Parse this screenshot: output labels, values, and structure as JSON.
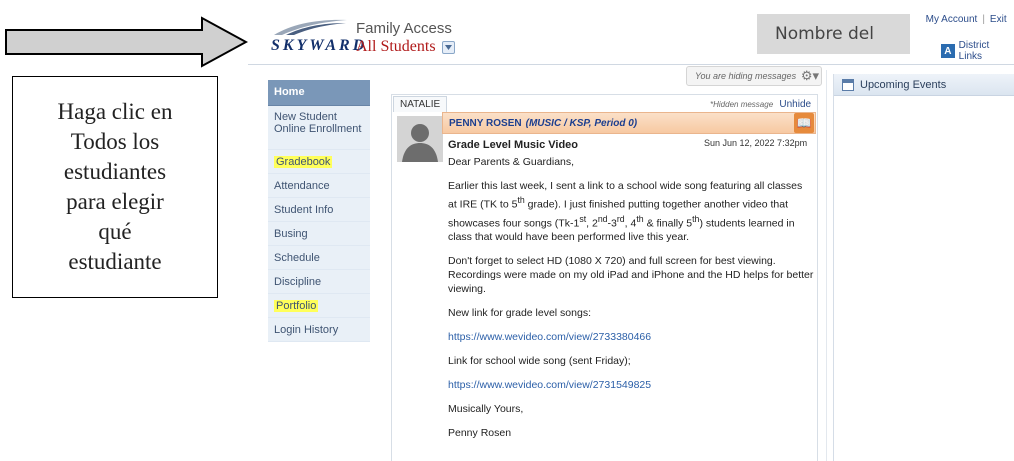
{
  "callout": {
    "lines": [
      "Haga clic en",
      "Todos los",
      "estudiantes",
      "para elegir",
      "qué",
      "estudiante"
    ]
  },
  "name_overlay": "Nombre del",
  "header": {
    "app_title": "Family Access",
    "student_selector": "All Students",
    "logo_text": "SKYWARD",
    "top_links": [
      "My Account",
      "Exit"
    ],
    "district_link": "District Links"
  },
  "sidebar": {
    "items": [
      {
        "label": "Home"
      },
      {
        "label": "New Student Online Enrollment"
      },
      {
        "label": "Gradebook"
      },
      {
        "label": "Attendance"
      },
      {
        "label": "Student Info"
      },
      {
        "label": "Busing"
      },
      {
        "label": "Schedule"
      },
      {
        "label": "Discipline"
      },
      {
        "label": "Portfolio"
      },
      {
        "label": "Login History"
      }
    ]
  },
  "messages": {
    "hiding_text": "You are hiding messages",
    "tab": "NATALIE",
    "hidden_note": "*Hidden message",
    "unhide": "Unhide",
    "sender": "PENNY ROSEN",
    "sender_class": "(MUSIC / KSP, Period 0)",
    "subject": "Grade Level Music Video",
    "timestamp": "Sun Jun 12, 2022 7:32pm",
    "greeting": "Dear Parents & Guardians,",
    "para1_line1": "Earlier this last week, I sent a link to a school wide song featuring all classes",
    "para1_line2_a": "at IRE (TK to 5",
    "para1_line2_b": "th",
    "para1_line2_c": " grade).  I just finished putting together another video that",
    "para1_line3_a": "showcases four songs (Tk-1",
    "para1_line3_b": "st",
    "para1_line3_c": ", 2",
    "para1_line3_d": "nd",
    "para1_line3_e": "-3",
    "para1_line3_f": "rd",
    "para1_line3_g": ", 4",
    "para1_line3_h": "th",
    "para1_line3_i": " & finally 5",
    "para1_line3_j": "th",
    "para1_line3_k": ") students learned in",
    "para1_line4": "class that would have been performed live this year.",
    "para2": "Don't forget to select HD (1080 X 720) and full screen for best viewing. Recordings were made on my old iPad and iPhone and the HD helps for better viewing.",
    "link1_label": "New link for grade level songs:",
    "link1": "https://www.wevideo.com/view/2733380466",
    "link2_label": "Link for school wide song (sent Friday);",
    "link2": "https://www.wevideo.com/view/2731549825",
    "closing": "Musically Yours,",
    "signature": "Penny Rosen"
  },
  "events": {
    "title": "Upcoming Events"
  },
  "colors": {
    "accent": "#13306b",
    "sidebar_home": "#7a97b8",
    "highlight": "#ffff5a",
    "message_header": "#f7c9a2",
    "link": "#2b5fa8"
  }
}
